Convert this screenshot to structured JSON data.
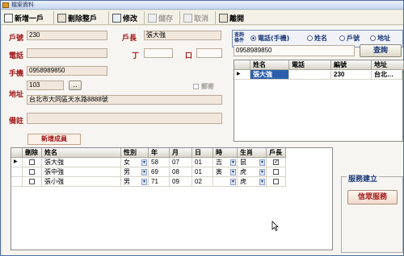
{
  "window": {
    "title": "檔案資料"
  },
  "toolbar": {
    "new_household": "新增一戶",
    "delete_household": "刪除整戶",
    "edit": "修改",
    "save": "儲存",
    "cancel": "取消",
    "leave": "離開"
  },
  "form": {
    "household_label": "戶號",
    "household_value": "230",
    "head_label": "戶長",
    "head_value": "張大強",
    "phone_label": "電話",
    "phone_value": "",
    "ding_label": "丁",
    "kou_label": "口",
    "mobile_label": "手機",
    "mobile_value": "0958989850",
    "address_label": "地址",
    "address_code": "103",
    "address_ellipsis": "..",
    "address_value": "台北市大同區天水路8888號",
    "mail_label": "郵寄",
    "notes_label": "備註",
    "notes_value": "",
    "add_member": "新增成員"
  },
  "search": {
    "criteria_label": "查詢條件",
    "options": [
      "電話(手機)",
      "姓名",
      "戶號",
      "地址"
    ],
    "selected": "電話(手機)",
    "input_value": "0958989850",
    "query_button": "查詢",
    "columns": [
      "姓名",
      "電話",
      "編號",
      "地址"
    ],
    "rows": [
      {
        "name": "張大強",
        "phone": "",
        "id": "230",
        "address": "台北…"
      }
    ]
  },
  "members": {
    "columns": [
      "刪除",
      "姓名",
      "性別",
      "年",
      "月",
      "日",
      "時",
      "生肖",
      "戶長"
    ],
    "rows": [
      {
        "name": "張大強",
        "gender": "女",
        "year": "58",
        "month": "07",
        "day": "01",
        "hour": "吉",
        "zodiac": "鼠",
        "is_head": true,
        "delete": false
      },
      {
        "name": "張中強",
        "gender": "男",
        "year": "69",
        "month": "08",
        "day": "01",
        "hour": "寅",
        "zodiac": "虎",
        "is_head": false,
        "delete": false
      },
      {
        "name": "張小強",
        "gender": "男",
        "year": "71",
        "month": "09",
        "day": "02",
        "hour": "",
        "zodiac": "虎",
        "is_head": false,
        "delete": false
      }
    ]
  },
  "service": {
    "title": "服務建立",
    "button": "信眾服務"
  }
}
